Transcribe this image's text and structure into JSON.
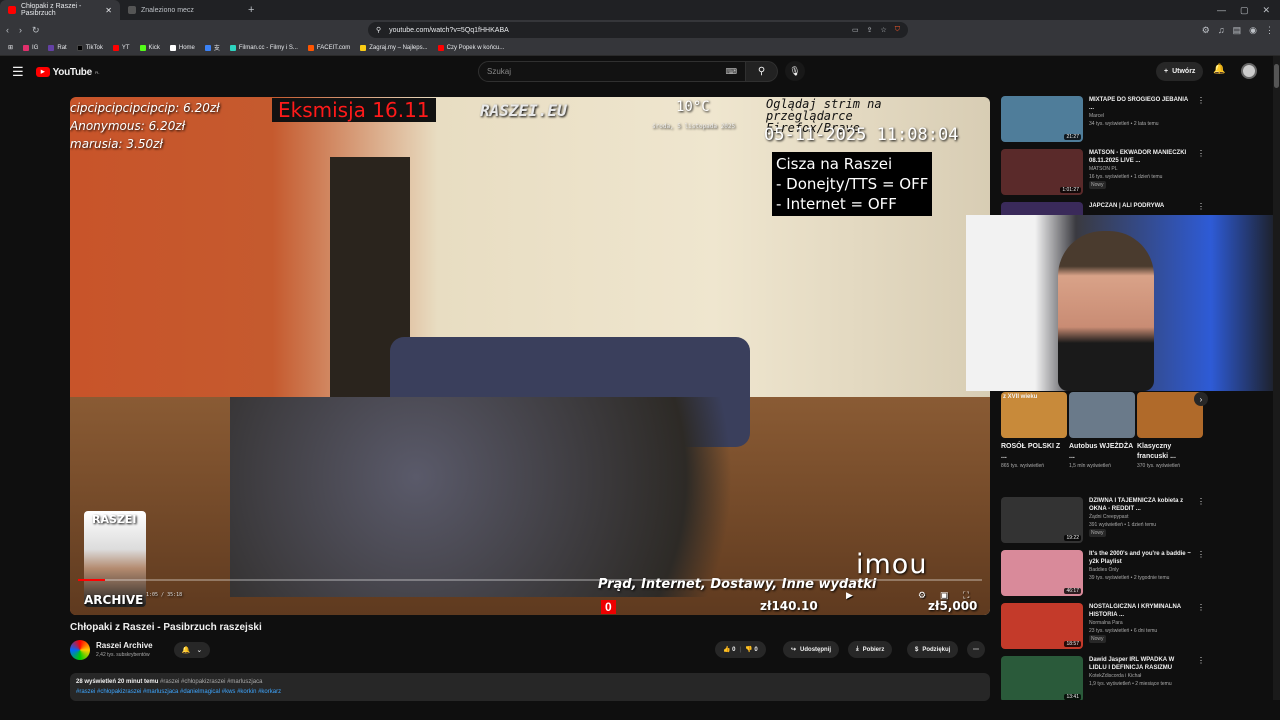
{
  "browser": {
    "tabs": [
      {
        "label": "Chłopaki z Raszei - Pasibrzuch",
        "active": true
      },
      {
        "label": "Znaleziono mecz",
        "active": false
      }
    ],
    "url": "youtube.com/watch?v=5Qq1fHHKABA",
    "bookmarks": [
      "IG",
      "Rat",
      "TikTok",
      "YT",
      "Kick",
      "Home",
      "支",
      "Filman.cc - Filmy i S...",
      "FACEIT.com",
      "Zagraj.my – Najleps...",
      "Czy Popek w końcu..."
    ]
  },
  "youtube": {
    "logo": "YouTube",
    "region": "PL",
    "search_placeholder": "Szukaj",
    "create_label": "Utwórz"
  },
  "player": {
    "donations": [
      "cipcipcipcipcipcip: 6.20zł",
      "Anonymous: 6.20zł",
      "marusia: 3.50zł"
    ],
    "eviction": "Eksmisja 16.11",
    "watermark": "RASZEI.EU",
    "temperature": "10°C",
    "weekday_date": "środa, 5 listopada 2025",
    "promo": "Oglądaj strim na przeglądarce Firefox/Brave",
    "clock": "05-11-2025 11:08:04",
    "status_lines": [
      "Cisza na Raszei",
      "- Donejty/TTS = OFF",
      "- Internet = OFF"
    ],
    "host_label": "RASZEI",
    "archive_label": "ARCHIVE",
    "brand": "imou",
    "bills_label": "Prąd, Internet, Dostawy, Inne wydatki",
    "goal_progress": "0",
    "goal_current": "zł140.10",
    "goal_target": "zł5,000",
    "timecode": "1:05 / 35:18",
    "played_fraction": 0.03
  },
  "video": {
    "title": "Chłopaki z Raszei - Pasibrzuch raszejski",
    "channel": "Raszei Archive",
    "subscribers": "2,42 tys. subskrybentów",
    "likes": "0",
    "dislikes": "0",
    "share": "Udostępnij",
    "download": "Pobierz",
    "thanks": "Podziękuj",
    "views_time": "28 wyświetleń  20 minut temu",
    "hashtags_line1": "#raszei #chłopakizraszei #marluszjaca",
    "hashtags_line2": "#raszei #chłopakizraszei #marluszjaca #danielmagical #kws #korkin #korkarz"
  },
  "sidebar": [
    {
      "title": "MIXTAPE DO SROGIEGO JEBANIA ...",
      "channel": "Marcel",
      "meta": "34 tys. wyświetleń • 2 lata temu",
      "duration": "21:27",
      "color": "#4f7d9a"
    },
    {
      "title": "MATSON - EKWADOR MANIECZKI 08.11.2025 LIVE ...",
      "channel": "MATSON PL",
      "meta": "16 tys. wyświetleń • 1 dzień temu",
      "badge": "Nowy",
      "duration": "1:01:27",
      "color": "#5a2a2a"
    },
    {
      "title": "JAPCZAN | ALI PODRYWA",
      "channel": "",
      "meta": "",
      "duration": "",
      "color": "#3a2a5a"
    }
  ],
  "shorts": [
    {
      "title": "ROSÓŁ POLSKI Z ...",
      "views": "865 tys. wyświetleń",
      "color": "#c88a3a"
    },
    {
      "title": "Autobus WJEŻDŻA ...",
      "views": "1,5 mln wyświetleń",
      "color": "#6a7a8a"
    },
    {
      "title": "Klasyczny francuski ...",
      "views": "370 tys. wyświetleń",
      "color": "#b06a2a"
    }
  ],
  "shorts_banner": "z XVII wieku",
  "sidebar2": [
    {
      "title": "DZIWNA I TAJEMNICZA kobieta z OKNA - REDDIT ...",
      "channel": "Żądni Creepypast",
      "meta": "391 wyświetleń • 1 dzień temu",
      "badge": "Nowy",
      "duration": "19:22",
      "color": "#333333"
    },
    {
      "title": "It's the 2000's and you're a baddie ~ y2k Playlist",
      "channel": "Baddies Only",
      "meta": "39 tys. wyświetleń • 2 tygodnie temu",
      "duration": "46:17",
      "color": "#d98a9a"
    },
    {
      "title": "NOSTALGICZNA I KRYMINALNA HISTORIA ...",
      "channel": "Normalna Para",
      "meta": "23 tys. wyświetleń • 6 dni temu",
      "badge": "Nowy",
      "duration": "18:57",
      "color": "#c43a2a"
    },
    {
      "title": "Dawid Jasper IRL WPADKA W LIDLU I DEFINICJA RASIZMU",
      "channel": "KotekZdiscorda i Kichał",
      "meta": "1,9 tys. wyświetleń • 2 miesiące temu",
      "duration": "13:41",
      "color": "#2a5a3a"
    }
  ]
}
